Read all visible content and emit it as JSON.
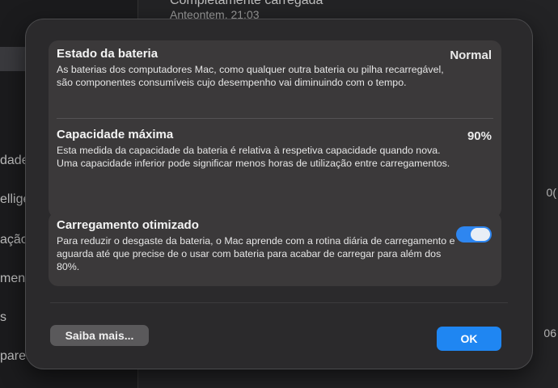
{
  "background": {
    "top_text": "Completamente carregada",
    "top_subtext": "Anteontem, 21:03",
    "sidebar_fragments": [
      "dade",
      "ellige",
      "ação",
      "men",
      "s",
      "pared"
    ],
    "right_fragments": [
      "0(",
      "06"
    ]
  },
  "sheet": {
    "battery_health": {
      "title": "Estado da bateria",
      "value": "Normal",
      "description": "As baterias dos computadores Mac, como qualquer outra bateria ou pilha recarregável, são componentes consumíveis cujo desempenho vai diminuindo com o tempo."
    },
    "max_capacity": {
      "title": "Capacidade máxima",
      "value": "90%",
      "description": "Esta medida da capacidade da bateria é relativa à respetiva capacidade quando nova. Uma capacidade inferior pode significar menos horas de utilização entre carregamentos."
    },
    "optimized_charging": {
      "title": "Carregamento otimizado",
      "enabled": true,
      "description": "Para reduzir o desgaste da bateria, o Mac aprende com a rotina diária de carregamento e aguarda até que precise de o usar com bateria para acabar de carregar para além dos 80%."
    },
    "learn_more_label": "Saiba mais...",
    "ok_label": "OK"
  },
  "colors": {
    "accent": "#1f86f2",
    "sheet_bg": "#2b2a2c",
    "card_bg": "#3b393a"
  }
}
